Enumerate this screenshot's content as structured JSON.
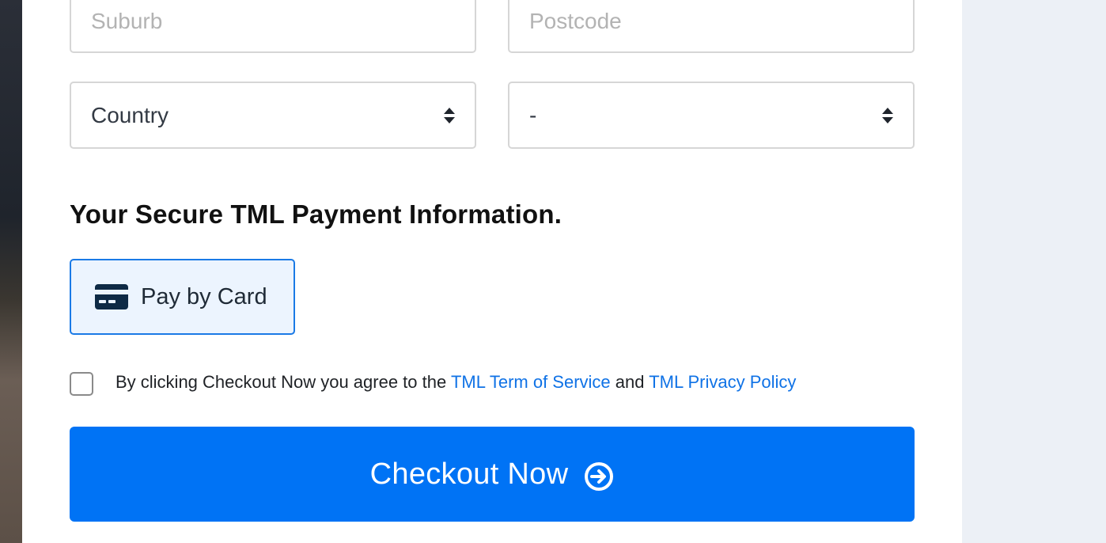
{
  "form": {
    "suburb_placeholder": "Suburb",
    "postcode_placeholder": "Postcode",
    "country_value": "Country",
    "state_value": "-"
  },
  "payment": {
    "section_title": "Your Secure TML Payment Information.",
    "pay_by_card_label": "Pay by Card",
    "card_icon": "credit-card-icon"
  },
  "terms": {
    "prefix": "By clicking Checkout Now you agree to the ",
    "terms_link": "TML Term of Service",
    "and": " and ",
    "privacy_link": "TML Privacy Policy"
  },
  "checkout": {
    "label": "Checkout Now",
    "icon": "arrow-right-circle-icon"
  },
  "colors": {
    "accent": "#0073f5",
    "link": "#0f72e6",
    "selected_bg": "#ecf4fe"
  }
}
